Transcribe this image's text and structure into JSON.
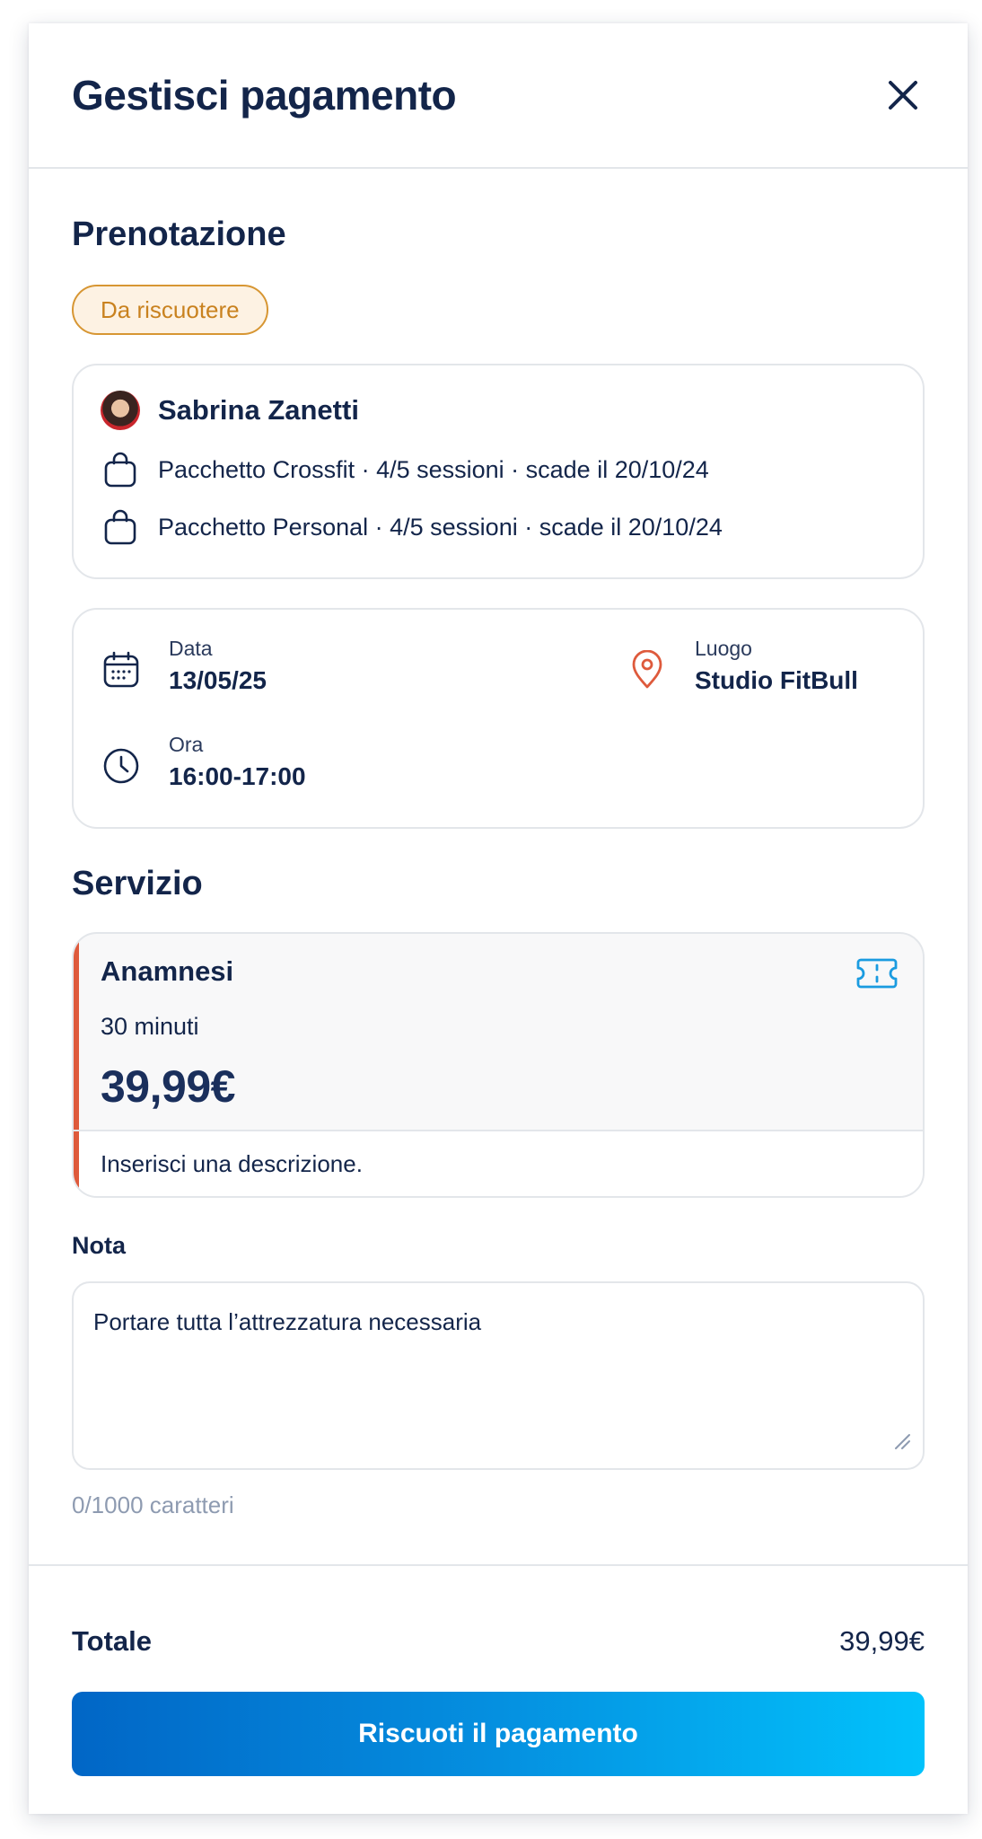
{
  "header": {
    "title": "Gestisci pagamento"
  },
  "booking": {
    "section_title": "Prenotazione",
    "status_badge": "Da riscuotere",
    "client_name": "Sabrina Zanetti",
    "packages": [
      "Pacchetto Crossfit · 4/5 sessioni · scade il 20/10/24",
      "Pacchetto Personal · 4/5 sessioni · scade il 20/10/24"
    ],
    "date_label": "Data",
    "date_value": "13/05/25",
    "time_label": "Ora",
    "time_value": "16:00-17:00",
    "place_label": "Luogo",
    "place_value": "Studio FitBull"
  },
  "service": {
    "section_title": "Servizio",
    "name": "Anamnesi",
    "duration": "30 minuti",
    "price": "39,99€",
    "description_placeholder": "Inserisci una descrizione."
  },
  "note": {
    "label": "Nota",
    "value": "Portare tutta l’attrezzatura necessaria",
    "char_count": "0/1000 caratteri"
  },
  "footer": {
    "total_label": "Totale",
    "total_value": "39,99€",
    "cta_label": "Riscuoti il pagamento"
  },
  "colors": {
    "text_primary": "#13254a",
    "badge_text": "#c9821f",
    "badge_bg": "#fdf2e3",
    "accent_orange": "#de5a3c",
    "icon_blue": "#1a9be0",
    "cta_gradient_start": "#0166c6",
    "cta_gradient_end": "#02c2fb"
  },
  "icons": {
    "close": "close-icon",
    "package": "shopping-bag-icon",
    "date": "calendar-icon",
    "time": "clock-icon",
    "place": "location-pin-icon",
    "service": "ticket-icon",
    "resize": "resize-handle-icon"
  }
}
